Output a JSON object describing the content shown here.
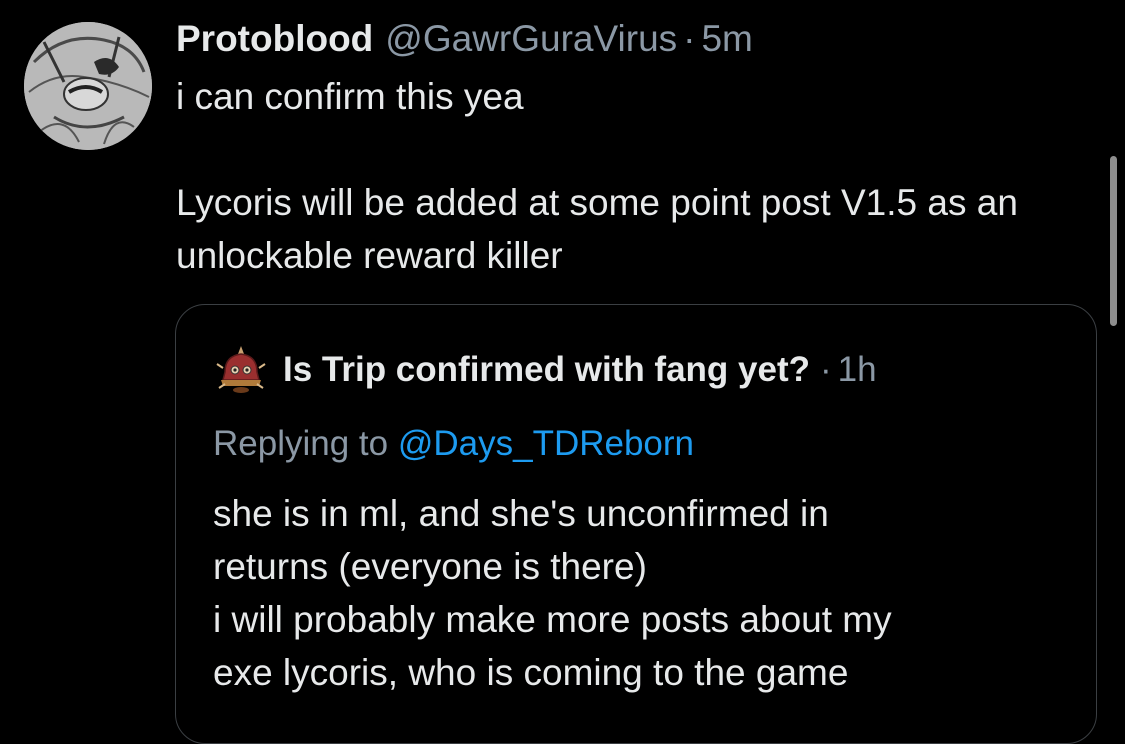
{
  "tweet": {
    "display_name": "Protoblood",
    "handle": "@GawrGuraVirus",
    "separator": "·",
    "time": "5m",
    "text_line1": "i can confirm this yea",
    "text_line2": "Lycoris will be added at some point post V1.5 as an unlockable reward killer",
    "avatar_icon": "sketch-character-avatar-icon"
  },
  "quote": {
    "display_name": "Is Trip confirmed with fang yet?",
    "separator": "·",
    "time": "1h",
    "replying_prefix": "Replying to ",
    "replying_handle": "@Days_TDReborn",
    "text_lines": [
      "she is in ml, and she's unconfirmed in",
      "returns (everyone is there)",
      "i will probably make more posts about my",
      "exe lycoris, who is coming to the game"
    ],
    "avatar_icon": "bell-character-avatar-icon"
  },
  "colors": {
    "background": "#000000",
    "primary_text": "#e7e9ea",
    "secondary_text": "#8b98a5",
    "link": "#1d9bf0",
    "border": "#3b3f43"
  }
}
